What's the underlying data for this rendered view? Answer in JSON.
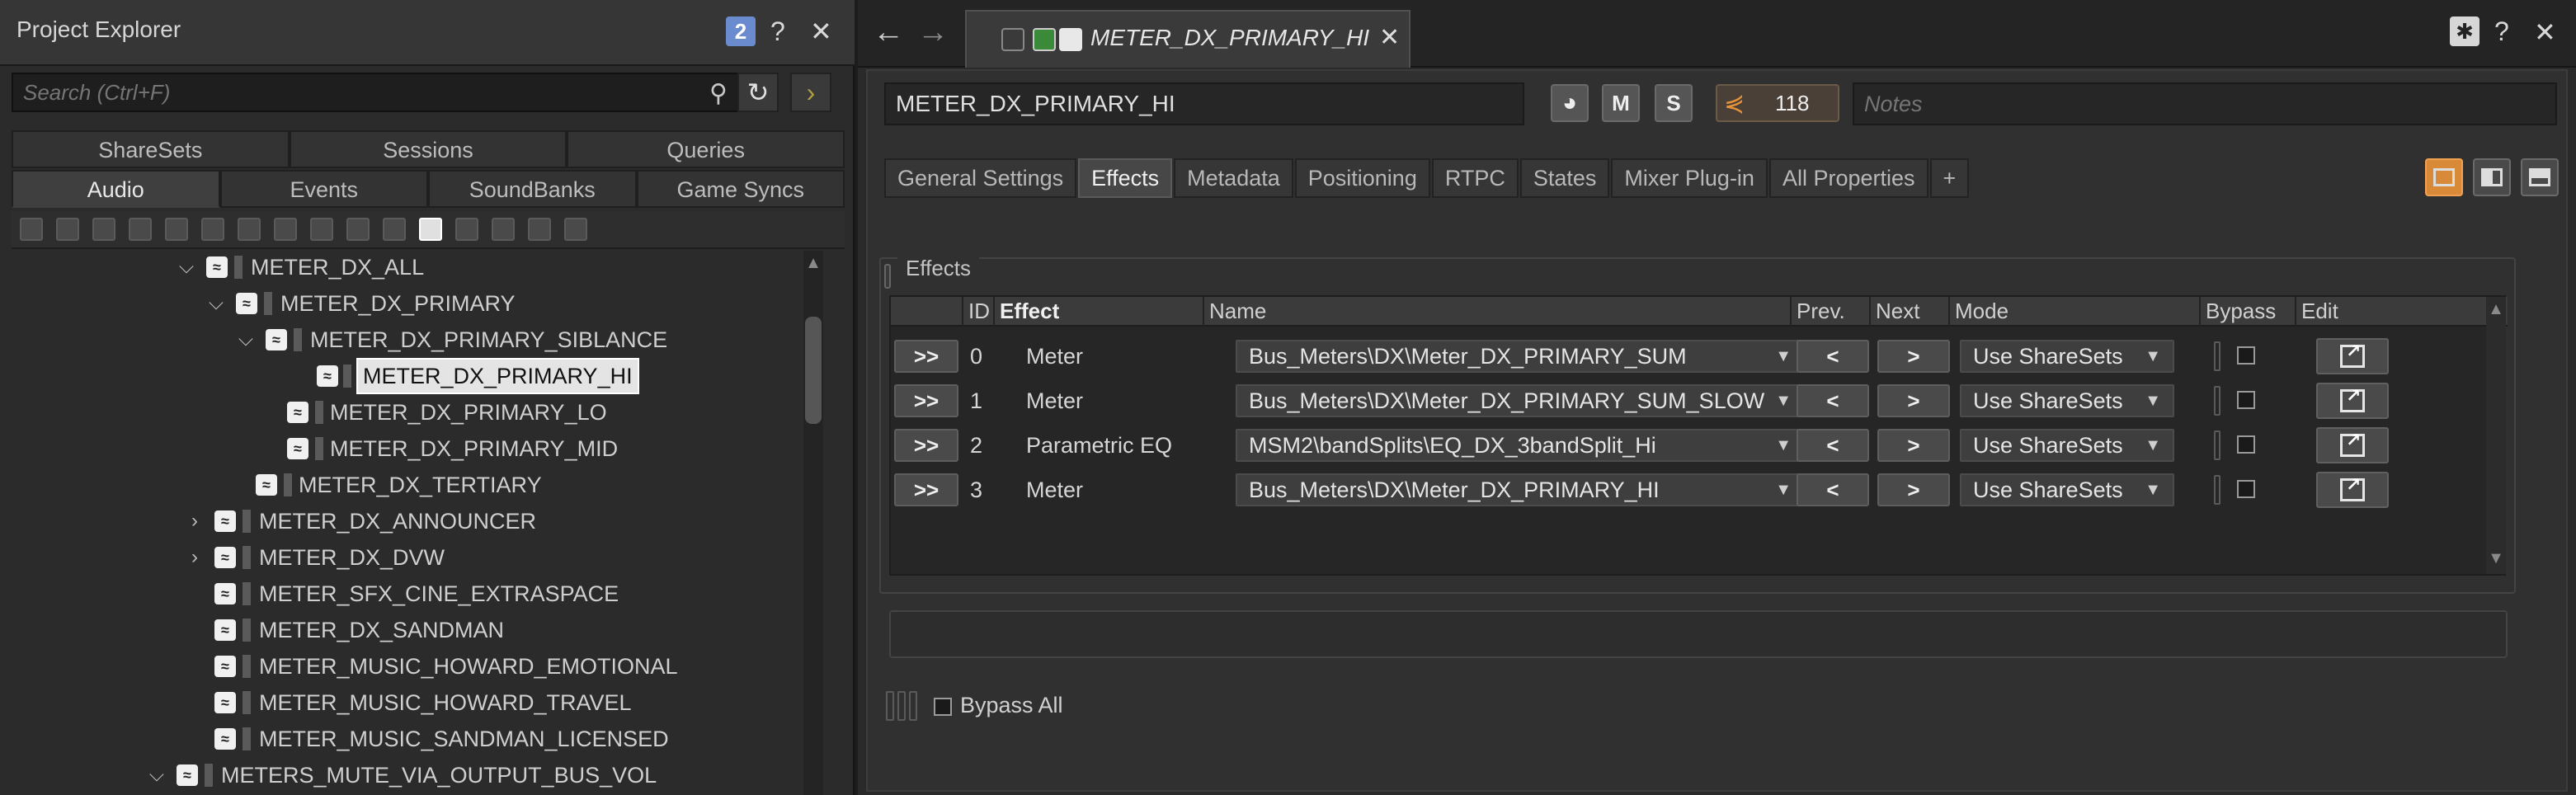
{
  "left": {
    "title": "Project Explorer",
    "badge": "2",
    "help_icon": "?",
    "close_icon": "✕",
    "search_placeholder": "Search (Ctrl+F)",
    "tabs_top": [
      "ShareSets",
      "Sessions",
      "Queries"
    ],
    "tabs_bottom": [
      "Audio",
      "Events",
      "SoundBanks",
      "Game Syncs"
    ],
    "active_tab": "Audio",
    "tree": [
      {
        "label": "METER_DX_ALL",
        "level": 0,
        "chev": "v"
      },
      {
        "label": "METER_DX_PRIMARY",
        "level": 1,
        "chev": "v"
      },
      {
        "label": "METER_DX_PRIMARY_SIBLANCE",
        "level": 2,
        "chev": "v"
      },
      {
        "label": "METER_DX_PRIMARY_HI",
        "level": 3,
        "chev": "",
        "selected": true
      },
      {
        "label": "METER_DX_PRIMARY_LO",
        "level": 3,
        "chev": ""
      },
      {
        "label": "METER_DX_PRIMARY_MID",
        "level": 3,
        "chev": ""
      },
      {
        "label": "METER_DX_TERTIARY",
        "level": 2,
        "chev": ""
      },
      {
        "label": "METER_DX_ANNOUNCER",
        "level": 0,
        "chev": ">"
      },
      {
        "label": "METER_DX_DVW",
        "level": 0,
        "chev": ">"
      },
      {
        "label": "METER_SFX_CINE_EXTRASPACE",
        "level": 0,
        "chev": ""
      },
      {
        "label": "METER_DX_SANDMAN",
        "level": 0,
        "chev": ""
      },
      {
        "label": "METER_MUSIC_HOWARD_EMOTIONAL",
        "level": 0,
        "chev": ""
      },
      {
        "label": "METER_MUSIC_HOWARD_TRAVEL",
        "level": 0,
        "chev": ""
      },
      {
        "label": "METER_MUSIC_SANDMAN_LICENSED",
        "level": 0,
        "chev": ""
      },
      {
        "label": "METERS_MUTE_VIA_OUTPUT_BUS_VOL",
        "level": -1,
        "chev": "v"
      }
    ]
  },
  "right": {
    "tab_title": "METER_DX_PRIMARY_HI",
    "name_value": "METER_DX_PRIMARY_HI",
    "btn_m": "M",
    "btn_s": "S",
    "share_count": "118",
    "notes_placeholder": "Notes",
    "prop_tabs": [
      "General Settings",
      "Effects",
      "Metadata",
      "Positioning",
      "RTPC",
      "States",
      "Mixer Plug-in",
      "All Properties",
      "+"
    ],
    "active_prop_tab": "Effects",
    "effects_group_label": "Effects",
    "columns": [
      "ID",
      "Effect",
      "Name",
      "Prev.",
      "Next",
      "Mode",
      "Bypass",
      "Edit"
    ],
    "rows": [
      {
        "btn": ">>",
        "id": "0",
        "effect": "Meter",
        "name": "Bus_Meters\\DX\\Meter_DX_PRIMARY_SUM",
        "prev": "<",
        "next": ">",
        "mode": "Use ShareSets"
      },
      {
        "btn": ">>",
        "id": "1",
        "effect": "Meter",
        "name": "Bus_Meters\\DX\\Meter_DX_PRIMARY_SUM_SLOW",
        "prev": "<",
        "next": ">",
        "mode": "Use ShareSets"
      },
      {
        "btn": ">>",
        "id": "2",
        "effect": "Parametric EQ",
        "name": "MSM2\\bandSplits\\EQ_DX_3bandSplit_Hi",
        "prev": "<",
        "next": ">",
        "mode": "Use ShareSets"
      },
      {
        "btn": ">>",
        "id": "3",
        "effect": "Meter",
        "name": "Bus_Meters\\DX\\Meter_DX_PRIMARY_HI",
        "prev": "<",
        "next": ">",
        "mode": "Use ShareSets"
      }
    ],
    "bypass_all": "Bypass All"
  },
  "colors": {
    "accent": "#d88a38",
    "badge": "#6a8ccf",
    "share": "#e8923a"
  }
}
